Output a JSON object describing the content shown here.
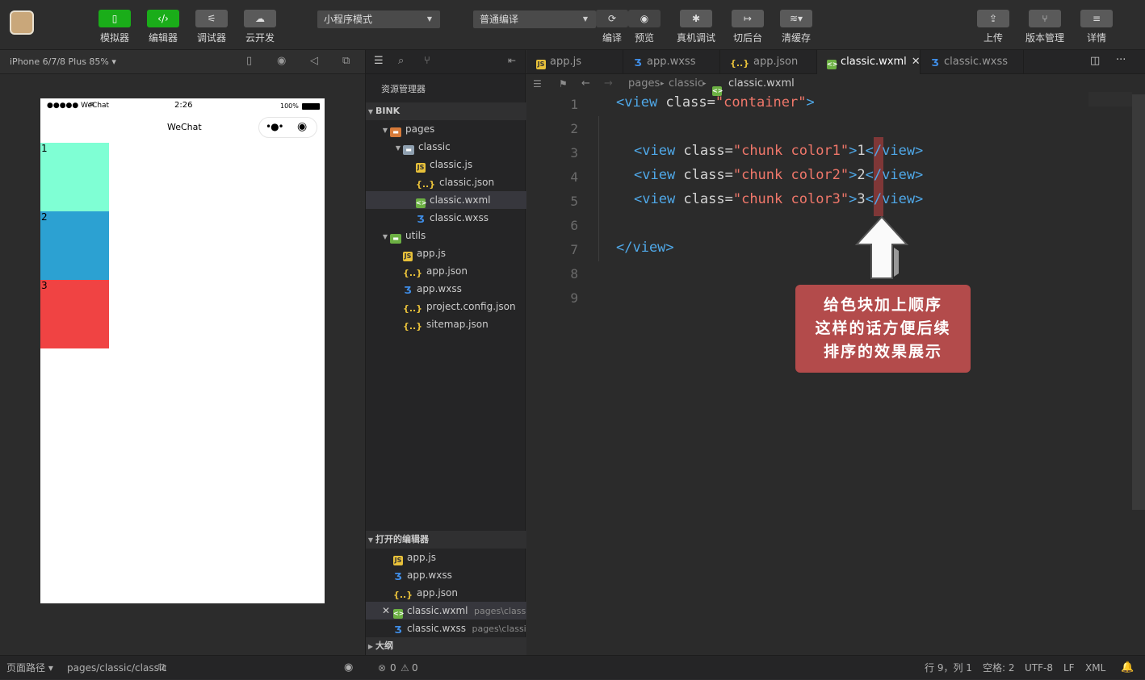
{
  "toolbar": {
    "simulator": "模拟器",
    "editor": "编辑器",
    "debugger": "调试器",
    "cloud": "云开发",
    "mode_select": "小程序模式",
    "compile_select": "普通编译",
    "compile": "编译",
    "preview": "预览",
    "real_debug": "真机调试",
    "background": "切后台",
    "clear_cache": "清缓存",
    "upload": "上传",
    "version": "版本管理",
    "details": "详情"
  },
  "device": {
    "label": "iPhone 6/7/8 Plus 85% ▾"
  },
  "phone": {
    "carrier": "●●●●● WeChat",
    "time": "2:26",
    "battery": "100%",
    "nav_title": "WeChat",
    "chunks": [
      {
        "label": "1",
        "color": "#7fffd4"
      },
      {
        "label": "2",
        "color": "#2ca1d2"
      },
      {
        "label": "3",
        "color": "#f04343"
      }
    ]
  },
  "explorer": {
    "title": "资源管理器",
    "project": "BINK",
    "tree": [
      {
        "label": "pages",
        "type": "fold"
      },
      {
        "label": "classic",
        "type": "foldb"
      },
      {
        "label": "classic.js",
        "type": "js"
      },
      {
        "label": "classic.json",
        "type": "json"
      },
      {
        "label": "classic.wxml",
        "type": "wxml"
      },
      {
        "label": "classic.wxss",
        "type": "wxss"
      },
      {
        "label": "utils",
        "type": "foldg"
      },
      {
        "label": "app.js",
        "type": "js"
      },
      {
        "label": "app.json",
        "type": "json"
      },
      {
        "label": "app.wxss",
        "type": "wxss"
      },
      {
        "label": "project.config.json",
        "type": "json"
      },
      {
        "label": "sitemap.json",
        "type": "json"
      }
    ],
    "open_editors_title": "打开的编辑器",
    "open_editors": [
      {
        "label": "app.js",
        "path": ""
      },
      {
        "label": "app.wxss",
        "path": ""
      },
      {
        "label": "app.json",
        "path": ""
      },
      {
        "label": "classic.wxml",
        "path": "pages\\classic"
      },
      {
        "label": "classic.wxss",
        "path": "pages\\classic"
      }
    ],
    "outline_title": "大纲"
  },
  "tabs": [
    {
      "label": "app.js"
    },
    {
      "label": "app.wxss"
    },
    {
      "label": "app.json"
    },
    {
      "label": "classic.wxml"
    },
    {
      "label": "classic.wxss"
    }
  ],
  "breadcrumb": {
    "p1": "pages",
    "p2": "classic",
    "p3": "classic.wxml"
  },
  "code": {
    "line_numbers": [
      "1",
      "2",
      "3",
      "4",
      "5",
      "6",
      "7",
      "8",
      "9"
    ],
    "lines": [
      {
        "tag_open": "<view",
        "attr": " class=",
        "value": "\"container\"",
        "close": ">"
      },
      {
        "tag_open": "<view",
        "attr": " class=",
        "value": "\"chunk color1\"",
        "close": ">",
        "text": "1",
        "end": "</view>"
      },
      {
        "tag_open": "<view",
        "attr": " class=",
        "value": "\"chunk color2\"",
        "close": ">",
        "text": "2",
        "end": "</view>"
      },
      {
        "tag_open": "<view",
        "attr": " class=",
        "value": "\"chunk color3\"",
        "close": ">",
        "text": "3",
        "end": "</view>"
      },
      {
        "end": "</view>"
      }
    ]
  },
  "callout": {
    "line1": "给色块加上顺序",
    "line2": "这样的话方便后续",
    "line3": "排序的效果展示"
  },
  "status": {
    "page_path_label": "页面路径 ▾",
    "page_path": "pages/classic/classic",
    "errors": "0",
    "warnings": "0",
    "cursor": "行 9，列 1",
    "spaces": "空格: 2",
    "encoding": "UTF-8",
    "eol": "LF",
    "lang": "XML"
  }
}
